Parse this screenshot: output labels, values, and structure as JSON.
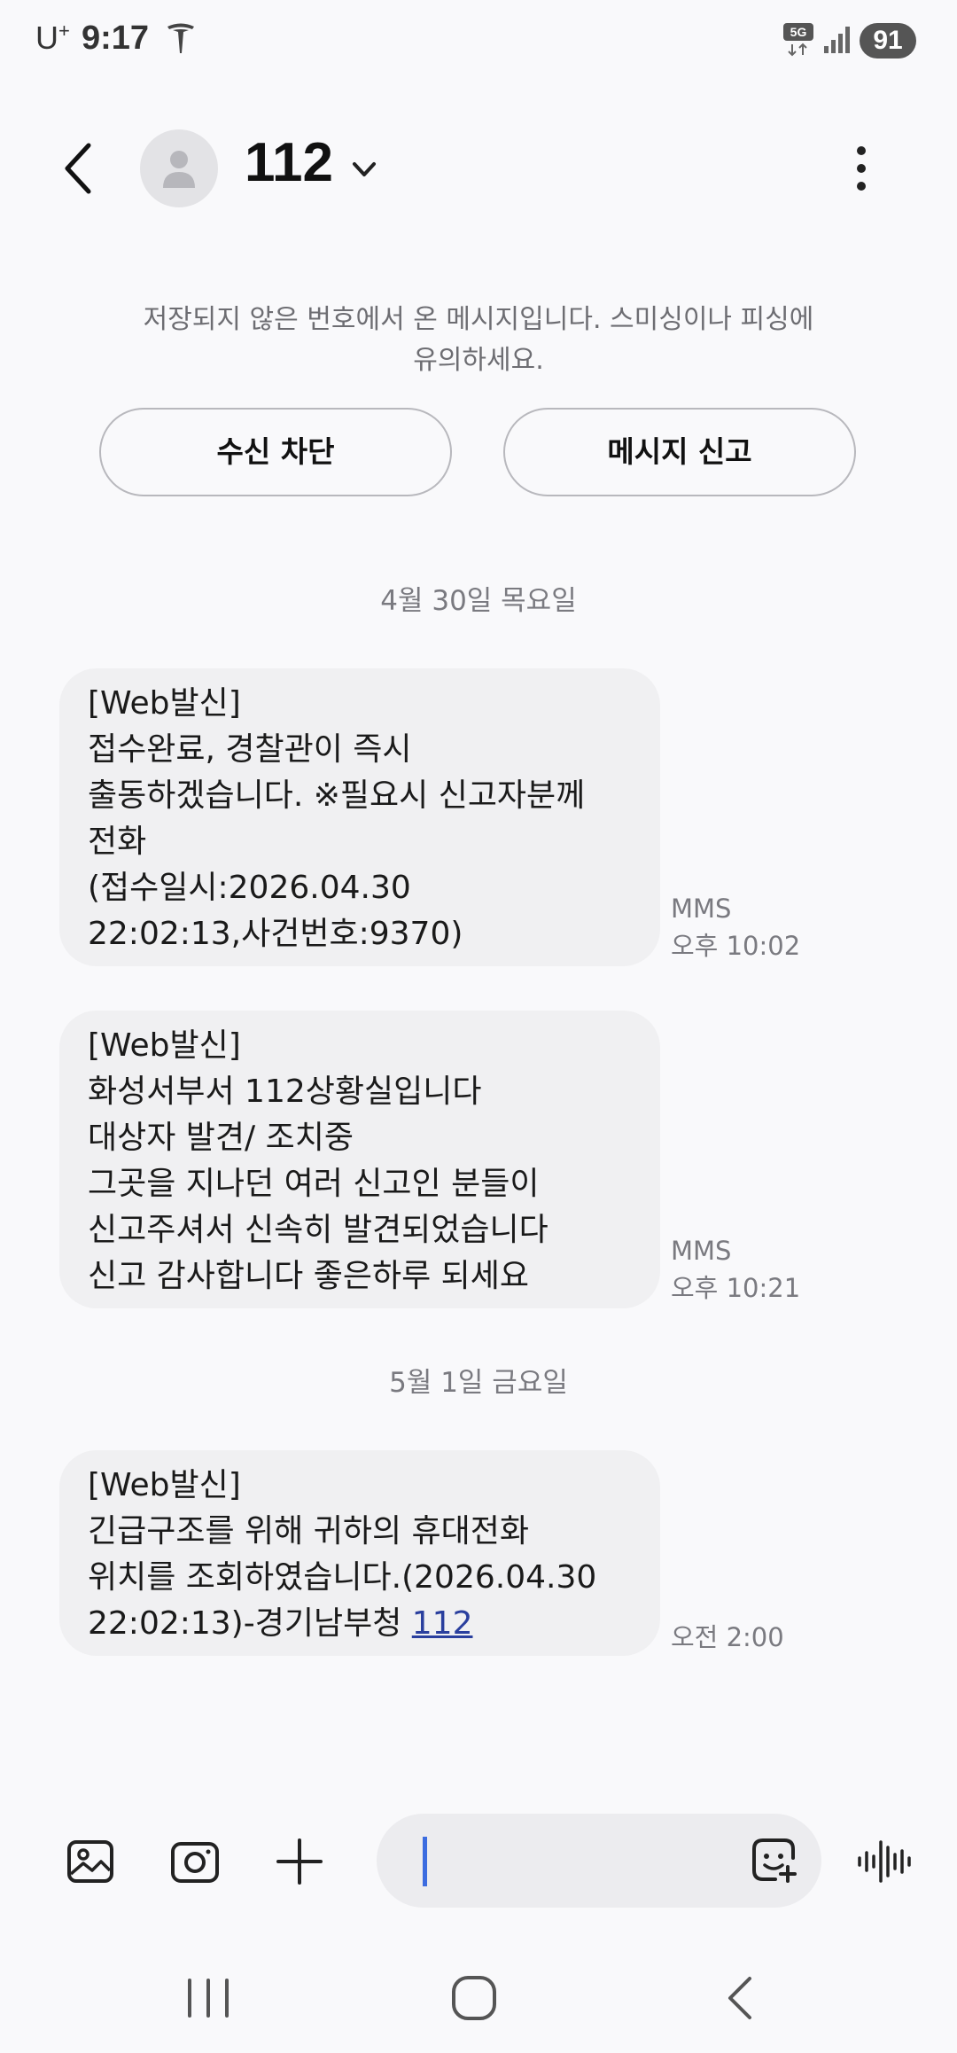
{
  "status_bar": {
    "carrier": "U",
    "carrier_sup": "+",
    "time": "9:17",
    "network": "5G",
    "battery": "91"
  },
  "header": {
    "contact_name": "112"
  },
  "warning": {
    "text_line1": "저장되지 않은 번호에서 온 메시지입니다. 스미싱이나 피싱에",
    "text_line2": "유의하세요.",
    "block_label": "수신 차단",
    "report_label": "메시지 신고"
  },
  "conversation": {
    "dates": [
      "4월 30일 목요일",
      "5월 1일 금요일"
    ],
    "messages": [
      {
        "lines": [
          "[Web발신]",
          "접수완료, 경찰관이 즉시",
          "출동하겠습니다. ※필요시 신고자분께",
          "전화",
          "(접수일시:2026.04.30",
          "22:02:13,사건번호:9370)"
        ],
        "type": "MMS",
        "time": "오후 10:02"
      },
      {
        "lines": [
          "[Web발신]",
          "화성서부서 112상황실입니다",
          "대상자 발견/ 조치중",
          "그곳을 지나던 여러 신고인 분들이",
          "신고주셔서 신속히 발견되었습니다",
          "신고 감사합니다 좋은하루 되세요"
        ],
        "type": "MMS",
        "time": "오후 10:21"
      },
      {
        "lines": [
          "[Web발신]",
          "긴급구조를 위해 귀하의 휴대전화",
          "위치를 조회하였습니다.(2026.04.30",
          "22:02:13)-경기남부청 "
        ],
        "link": "112",
        "type": "",
        "time": "오전 2:00"
      }
    ]
  },
  "composer": {
    "icons": [
      "gallery-icon",
      "camera-icon",
      "plus-icon",
      "emoji-icon",
      "voice-icon"
    ],
    "caret_color": "#3c6ce0"
  },
  "colors": {
    "background": "#f9f9fb",
    "bubble": "#f0f0f2",
    "link": "#2a3f9e"
  }
}
